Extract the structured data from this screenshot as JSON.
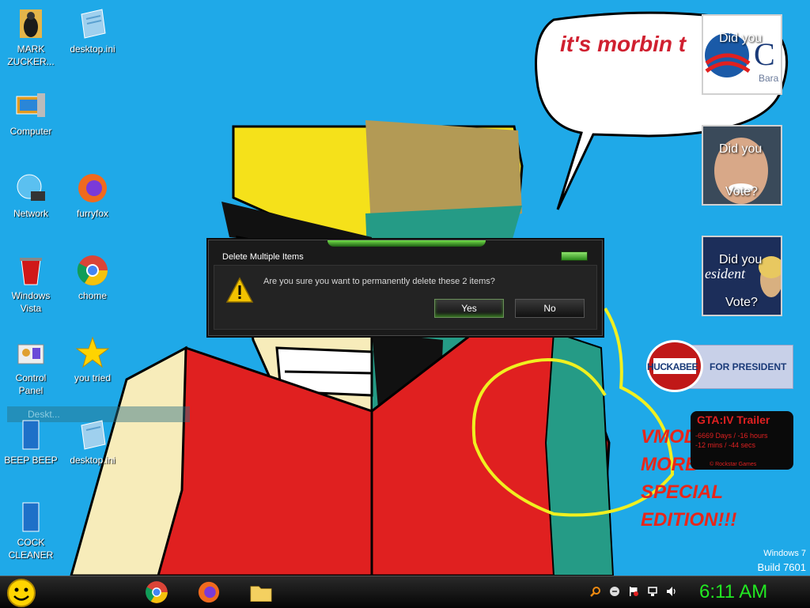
{
  "desktop": {
    "icons": [
      {
        "label": "MARK ZUCKER...",
        "icon": "folder-person-icon"
      },
      {
        "label": "desktop.ini",
        "icon": "ini-file-icon"
      },
      {
        "label": "Computer",
        "icon": "computer-icon"
      },
      {
        "label": "Network",
        "icon": "network-globe-icon"
      },
      {
        "label": "furryfox",
        "icon": "firefox-icon"
      },
      {
        "label": "Windows Vista",
        "icon": "recycle-bin-icon"
      },
      {
        "label": "chome",
        "icon": "chrome-icon"
      },
      {
        "label": "Control Panel",
        "icon": "control-panel-icon"
      },
      {
        "label": "you tried",
        "icon": "star-icon"
      },
      {
        "label": "BEEP BEEP",
        "icon": "blue-box-icon"
      },
      {
        "label": "desktop.ini",
        "icon": "ini-file-icon"
      },
      {
        "label": "COCK CLEANER",
        "icon": "blue-box-icon"
      }
    ],
    "drag_ghost_label": "Deskt..."
  },
  "wallpaper": {
    "speech_bubble": "it's morbin t",
    "vmod_text": [
      "VMOD",
      "MORB",
      "SPECIAL",
      "EDITION!!!"
    ]
  },
  "gadgets": {
    "vote1": {
      "line1": "Did you",
      "fragment": "Bara"
    },
    "vote2": {
      "line1": "Did you",
      "line2": "Vote?"
    },
    "vote3": {
      "line1": "Did you",
      "line2": "Vote?",
      "fragment": "esident"
    },
    "huckabee": {
      "name": "HUCKABEE",
      "tag": "FOR PRESIDENT"
    },
    "gta": {
      "title": "GTA:IV Trailer",
      "line1": "-6669 Days / -16 hours",
      "line2": "-12 mins / -44 secs",
      "footer": "©  Rockstar Games"
    }
  },
  "dialog": {
    "title": "Delete Multiple Items",
    "message": "Are you sure you want to permanently delete these 2 items?",
    "yes_label": "Yes",
    "no_label": "No"
  },
  "watermark": {
    "line1": "Windows 7",
    "line2": "Build 7601"
  },
  "taskbar": {
    "start_icon": "smiley-start-icon",
    "pinned": [
      "chrome-icon",
      "firefox-icon",
      "folder-icon"
    ],
    "tray": [
      "search-icon",
      "smiley-icon",
      "flag-icon",
      "network-icon",
      "volume-icon"
    ],
    "clock": "6:11 AM"
  },
  "colors": {
    "desktop_bg": "#1fa9e8",
    "clock": "#22e822",
    "dialog_accent": "#73e04a"
  }
}
